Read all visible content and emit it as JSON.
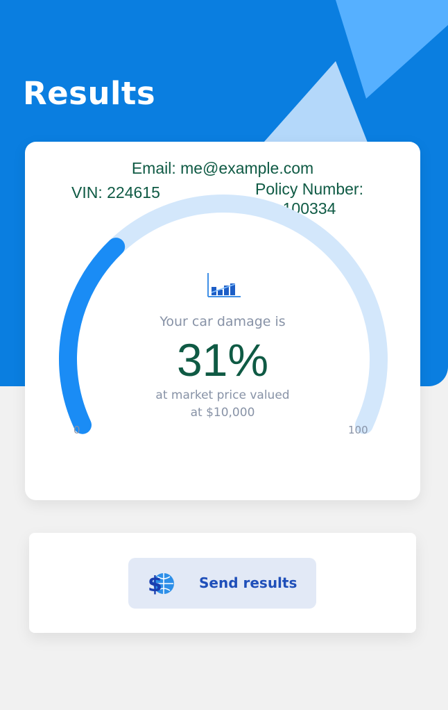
{
  "header": {
    "title": "Results"
  },
  "info": {
    "email": "Email: me@example.com",
    "vin": "VIN: 224615",
    "policy_label": "Policy Number:",
    "policy_number": "100334"
  },
  "gauge": {
    "value_percent": 31,
    "min_label": "0",
    "max_label": "100",
    "fill_color": "#1a8cf5",
    "track_color": "#d3e7fb"
  },
  "result": {
    "damage_label": "Your car damage is",
    "damage_value": "31%",
    "caption_line1": "at market price valued",
    "caption_line2": "at $10,000"
  },
  "actions": {
    "send_label": "Send results"
  },
  "icons": {
    "chart": "bar-chart-icon",
    "send": "globe-dollar-icon"
  },
  "colors": {
    "hero_background": "#0a7ee0",
    "accent_text": "#0f5a44",
    "button_background": "#e2e9f6",
    "button_text": "#1f4fb9"
  }
}
